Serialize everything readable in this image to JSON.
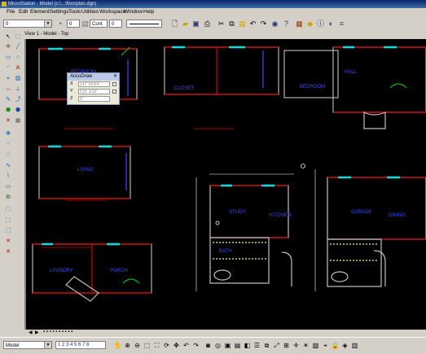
{
  "window": {
    "title": "MicroStation - Model (c:\\...\\floorplan.dgn)"
  },
  "menu": {
    "items": [
      "File",
      "Edit",
      "Element",
      "Settings",
      "Tools",
      "Utilities",
      "Workspace",
      "Window",
      "Help"
    ]
  },
  "toolbar": {
    "level_value": "0",
    "weight_value": "0",
    "linestyle_value": "Cont",
    "color_value": "0"
  },
  "view": {
    "title": "View 1 - Model - Top"
  },
  "accudraw": {
    "title": "AccuDraw",
    "x_label": "X",
    "x_value": "147' 55/64\"",
    "y_label": "Y",
    "y_value": "510' 3/16\"",
    "z_label": "Z",
    "z_value": "0\""
  },
  "drawing_labels": [
    "BEDROOM",
    "CLOSET",
    "BEDROOM",
    "HALL",
    "LIVING",
    "STUDY",
    "KITCHEN",
    "BATH",
    "GARAGE",
    "DINING",
    "LAUNDRY",
    "PORCH"
  ],
  "statusbar": {
    "model_value": "Model"
  },
  "colors": {
    "canvas_bg": "#000000",
    "wall_outer": "#c0c0c0",
    "wall_accent": "#ff0000",
    "window_lines": "#00ffff",
    "dimension_lines": "#ffffff",
    "labels": "#3a4cff",
    "doors": "#00c000"
  },
  "icons": {
    "palette": [
      "select-icon",
      "fence-icon",
      "line-icon",
      "arc-icon",
      "circle-icon",
      "text-icon",
      "dimension-icon",
      "cell-icon",
      "delete-icon",
      "modify-icon"
    ]
  }
}
